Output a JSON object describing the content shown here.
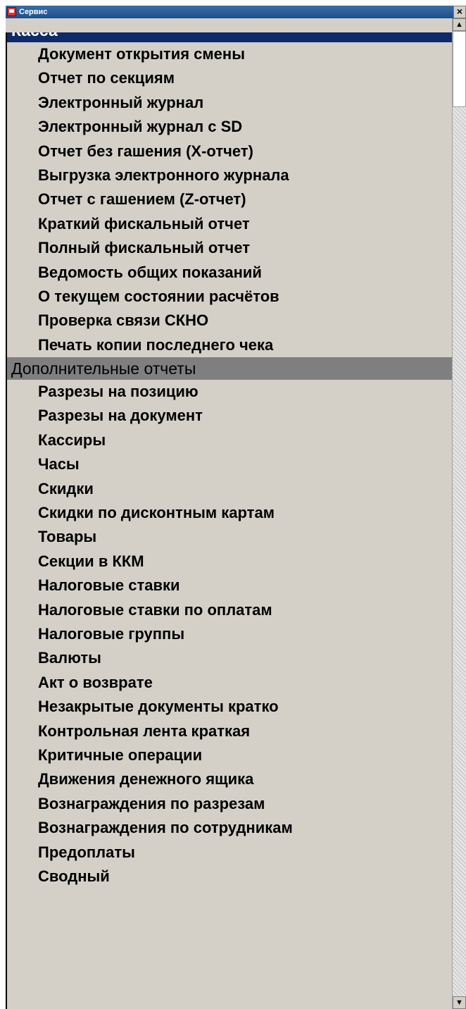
{
  "window": {
    "title": "Сервис"
  },
  "groups": [
    {
      "label": "Касса",
      "items": [
        "Документ открытия смены",
        "Отчет по секциям",
        "Электронный журнал",
        "Электронный журнал с SD",
        "Отчет без гашения (Х-отчет)",
        "Выгрузка электронного журнала",
        "Отчет с гашением (Z-отчет)",
        "Краткий фискальный отчет",
        "Полный фискальный отчет",
        "Ведомость общих показаний",
        "О текущем состоянии расчётов",
        "Проверка связи СКНО",
        "Печать копии последнего чека"
      ]
    },
    {
      "label": "Дополнительные отчеты",
      "items": [
        "Разрезы на позицию",
        "Разрезы на документ",
        "Кассиры",
        "Часы",
        "Скидки",
        "Скидки по дисконтным картам",
        "Товары",
        "Секции в ККМ",
        "Налоговые ставки",
        "Налоговые ставки по оплатам",
        "Налоговые группы",
        "Валюты",
        "Акт о возврате",
        "Незакрытые документы кратко",
        "Контрольная лента краткая",
        "Критичные операции",
        "Движения денежного ящика",
        "Вознаграждения по разрезам",
        "Вознаграждения по сотрудникам",
        "Предоплаты",
        "Сводный"
      ]
    }
  ],
  "icons": {
    "close": "close-icon",
    "scroll_up": "arrow-up-icon",
    "scroll_down": "arrow-down-icon"
  },
  "colors": {
    "selected_header_bg": "#0f2a6a",
    "secondary_header_bg": "#7f7f7f",
    "panel_bg": "#d4d0c8"
  }
}
